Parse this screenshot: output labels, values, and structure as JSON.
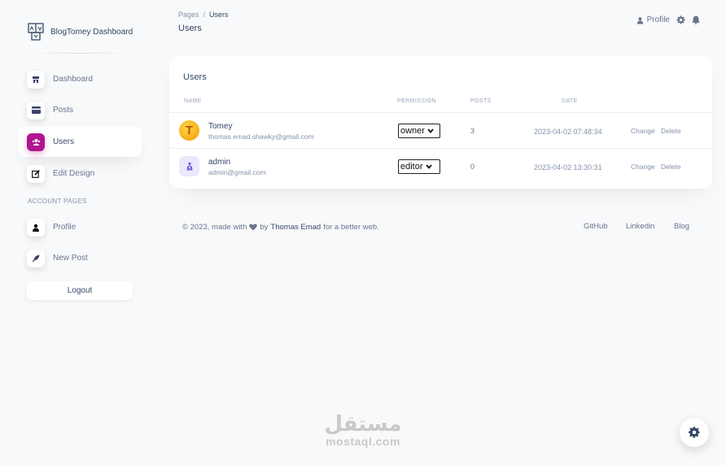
{
  "brand": {
    "name": "BlogTomey Dashboard",
    "logo_icon": "blog-logo-icon"
  },
  "sidebar": {
    "items": [
      {
        "label": "Dashboard",
        "icon": "shop-icon",
        "active": false
      },
      {
        "label": "Posts",
        "icon": "credit-card-icon",
        "active": false
      },
      {
        "label": "Users",
        "icon": "users-icon",
        "active": true
      },
      {
        "label": "Edit Design",
        "icon": "edit-icon",
        "active": false
      }
    ],
    "section_label": "ACCOUNT PAGES",
    "account_items": [
      {
        "label": "Profile",
        "icon": "user-icon"
      },
      {
        "label": "New Post",
        "icon": "rocket-icon"
      }
    ],
    "logout_label": "Logout"
  },
  "header": {
    "breadcrumb_root": "Pages",
    "breadcrumb_sep": "/",
    "breadcrumb_current": "Users",
    "title": "Users",
    "profile_label": "Profile"
  },
  "users_table": {
    "title": "Users",
    "columns": [
      "NAME",
      "PERMISSION",
      "POSTS",
      "DATE"
    ],
    "rows": [
      {
        "name": "Tomey",
        "email": "thomas.emad.shawky@gmail.com",
        "permission": "owner",
        "posts": "3",
        "date": "2023-04-02 07:48:34",
        "change": "Change",
        "delete": "Delete"
      },
      {
        "name": "admin",
        "email": "admin@gmail.com",
        "permission": "editor",
        "posts": "0",
        "date": "2023-04-02 13:30:31",
        "change": "Change",
        "delete": "Delete"
      }
    ]
  },
  "footer": {
    "copyright_prefix": "© 2023, made with",
    "by": "by",
    "author": "Thomas Emad",
    "suffix": "for a better web.",
    "links": [
      "GitHub",
      "Linkedin",
      "Blog"
    ]
  },
  "watermark": {
    "arabic": "مستقل",
    "latin": "mostaql.com"
  },
  "colors": {
    "accent": "#b0158f",
    "text": "#344767",
    "muted": "#8392ab",
    "background": "#f8f9fa"
  }
}
